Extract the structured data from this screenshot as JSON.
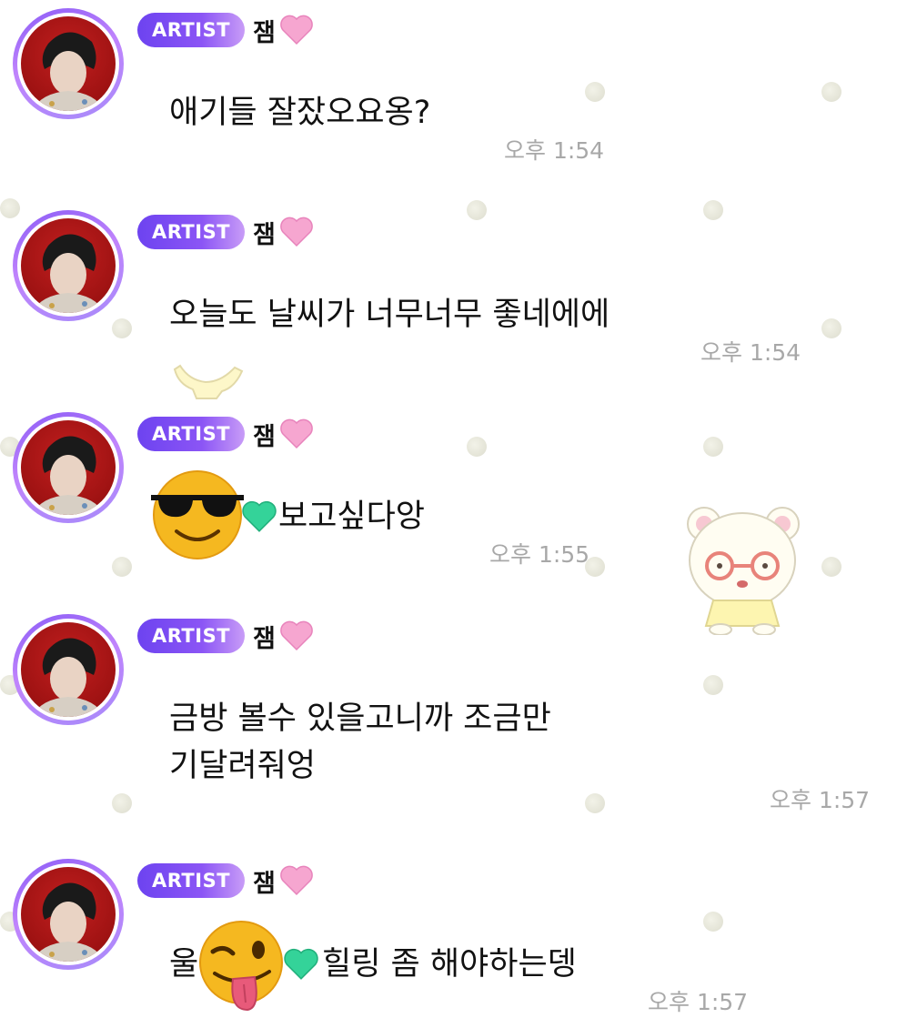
{
  "badge_label": "ARTIST",
  "messages": [
    {
      "sender": "잼",
      "text": "애기들 잘잤오요옹?",
      "time": "오후 1:54"
    },
    {
      "sender": "잼",
      "text": "오늘도 날씨가 너무너무 좋네에에",
      "time": "오후 1:54"
    },
    {
      "sender": "잼",
      "emoji_before": "smiling-face-with-sunglasses-icon",
      "text": "보고싶다앙",
      "time": "오후 1:55"
    },
    {
      "sender": "잼",
      "text_lines": [
        "금방 볼수 있을고니까 조금만",
        "기달려줘엉"
      ],
      "time": "오후 1:57"
    },
    {
      "sender": "잼",
      "text_prefix": "울",
      "emoji_mid": "winking-face-with-tongue-icon",
      "text": "힐링 좀 해야하는뎅",
      "time": "오후 1:57"
    }
  ],
  "colors": {
    "badge_gradient_start": "#6d43f0",
    "badge_gradient_end": "#c89cf7",
    "avatar_ring": "#a78bfa",
    "heart": "#f472b6",
    "green_heart": "#34d399",
    "timestamp": "#a8a8a8",
    "avatar_background": "#b01818"
  }
}
